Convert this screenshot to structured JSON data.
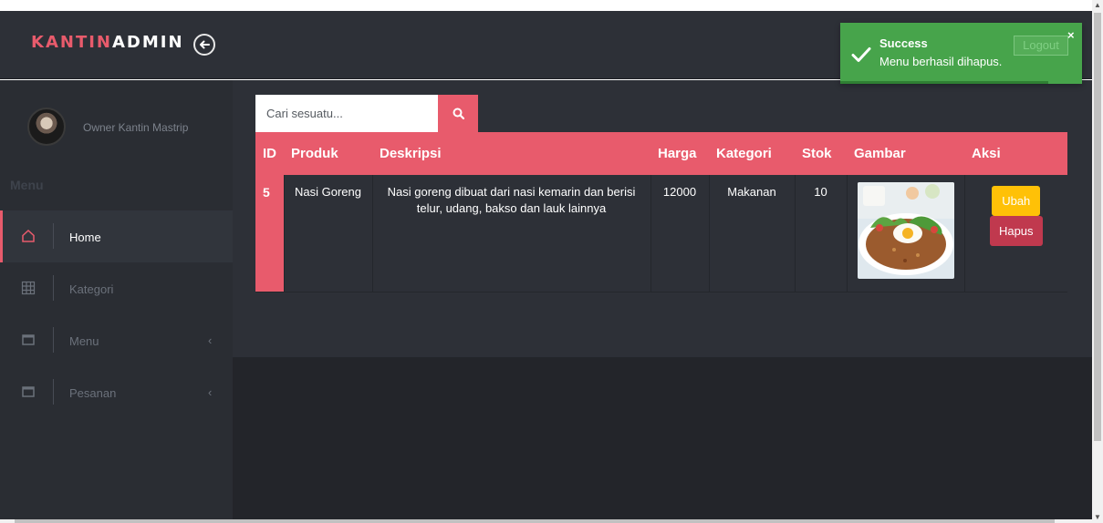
{
  "brand": {
    "part1": "KANTIN",
    "part2": "ADMIN"
  },
  "profile": {
    "name": "Owner Kantin Mastrip"
  },
  "sidebar": {
    "heading": "Menu",
    "items": [
      {
        "label": "Home",
        "icon": "home-icon",
        "active": true
      },
      {
        "label": "Kategori",
        "icon": "grid-icon",
        "active": false
      },
      {
        "label": "Menu",
        "icon": "window-icon",
        "active": false,
        "caret": "‹"
      },
      {
        "label": "Pesanan",
        "icon": "window-icon",
        "active": false,
        "caret": "‹"
      }
    ]
  },
  "search": {
    "placeholder": "Cari sesuatu..."
  },
  "table": {
    "headers": [
      "ID",
      "Produk",
      "Deskripsi",
      "Harga",
      "Kategori",
      "Stok",
      "Gambar",
      "Aksi"
    ],
    "rows": [
      {
        "id": "5",
        "produk": "Nasi Goreng",
        "deskripsi": "Nasi goreng dibuat dari nasi kemarin dan berisi telur, udang, bakso dan lauk lainnya",
        "harga": "12000",
        "kategori": "Makanan",
        "stok": "10",
        "edit_label": "Ubah",
        "delete_label": "Hapus"
      }
    ]
  },
  "toast": {
    "title": "Success",
    "message": "Menu berhasil dihapus.",
    "logout_label": "Logout",
    "close_label": "×"
  },
  "colors": {
    "accent": "#e85b6c",
    "header_bg": "#2d3037",
    "sidebar_bg": "#2a2d33",
    "success": "#47a44b",
    "warning": "#ffc107",
    "danger": "#c0394e"
  }
}
